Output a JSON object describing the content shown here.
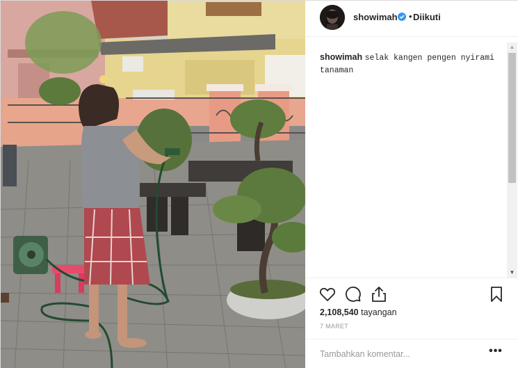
{
  "post": {
    "username": "showimah",
    "follow_status": "Diikuti",
    "separator": "•",
    "caption_user": "showimah",
    "caption_text": "selak kangen pengen nyirami tanaman",
    "views_count": "2,108,540",
    "views_label": "tayangan",
    "date": "7 MARET",
    "comment_placeholder": "Tambahkan komentar...",
    "more_options": "•••"
  },
  "icons": {
    "verified": "verified-badge-icon",
    "like": "heart-outline-icon",
    "comment": "speech-bubble-icon",
    "share": "share-arrow-icon",
    "save": "bookmark-icon",
    "more": "ellipsis-icon"
  },
  "colors": {
    "verified_blue": "#3897f0",
    "text": "#262626",
    "muted": "#999999",
    "border": "#efefef"
  }
}
